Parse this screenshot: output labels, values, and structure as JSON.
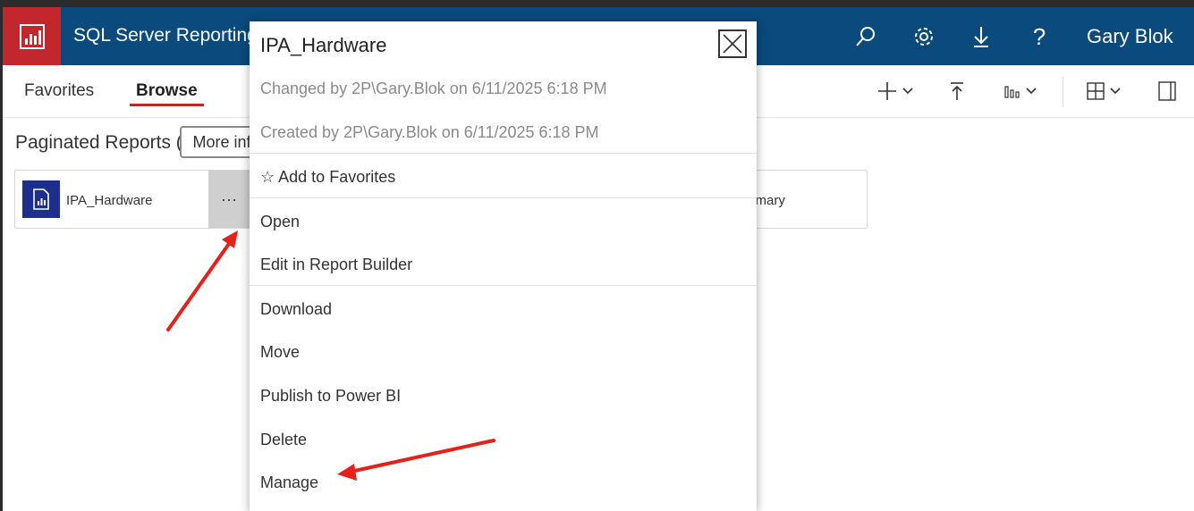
{
  "header": {
    "app_title": "SQL Server Reporting",
    "icons": [
      "search-icon",
      "gear-icon",
      "download-icon",
      "help-icon"
    ],
    "user_name": "Gary Blok",
    "brand_color": "#0a4a7c",
    "logo_color": "#c1272d"
  },
  "nav": {
    "tabs": [
      {
        "label": "Favorites",
        "active": false
      },
      {
        "label": "Browse",
        "active": true
      }
    ],
    "toolbar_icons": [
      "new-icon",
      "upload-icon",
      "view-options-icon",
      "tile-view-icon",
      "details-pane-icon"
    ]
  },
  "content": {
    "section_title": "Paginated Reports (",
    "tooltip": "More info",
    "tiles": [
      {
        "label": "IPA_Hardware",
        "more_label": "···"
      },
      {
        "label": "mmary"
      }
    ]
  },
  "popup": {
    "title": "IPA_Hardware",
    "changed": "Changed by 2P\\Gary.Blok on 6/11/2025 6:18 PM",
    "created": "Created by 2P\\Gary.Blok on 6/11/2025 6:18 PM",
    "favorites_icon": "☆",
    "favorites": "Add to Favorites",
    "open": "Open",
    "edit": "Edit in Report Builder",
    "download": "Download",
    "move": "Move",
    "publish": "Publish to Power BI",
    "delete": "Delete",
    "manage": "Manage"
  },
  "annotation_color": "#e8201a"
}
